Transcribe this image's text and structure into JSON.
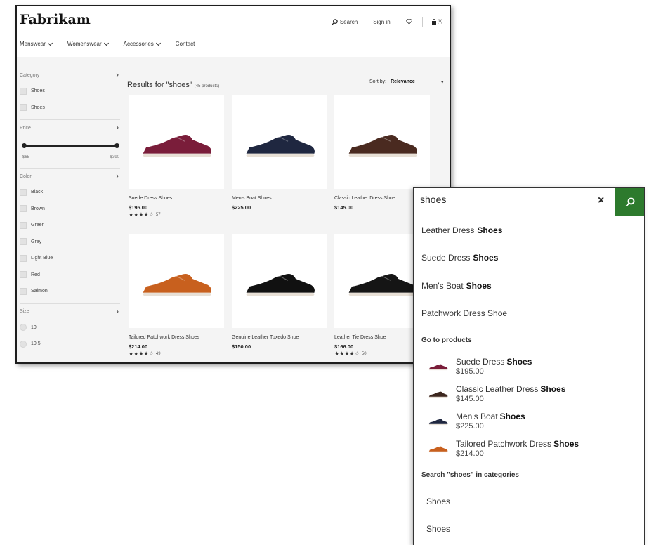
{
  "header": {
    "logo": "Fabrikam",
    "search_label": "Search",
    "signin_label": "Sign in",
    "cart_count": "(0)"
  },
  "nav": [
    {
      "label": "Menswear"
    },
    {
      "label": "Womenswear"
    },
    {
      "label": "Accessories"
    },
    {
      "label": "Contact"
    }
  ],
  "filters": {
    "category": {
      "title": "Category",
      "items": [
        "Shoes",
        "Shoes"
      ]
    },
    "price": {
      "title": "Price",
      "min": "$65",
      "max": "$390"
    },
    "color": {
      "title": "Color",
      "items": [
        "Black",
        "Brown",
        "Green",
        "Grey",
        "Light Blue",
        "Red",
        "Salmon"
      ]
    },
    "size": {
      "title": "Size",
      "items": [
        "10",
        "10.5"
      ]
    }
  },
  "results": {
    "title": "Results for \"shoes\"",
    "count": "(45 products)",
    "sort_label": "Sort by:",
    "sort_value": "Relevance",
    "sort_arrow": "▾"
  },
  "products": [
    {
      "name": "Suede Dress Shoes",
      "price": "$195.00",
      "stars": "★★★★☆",
      "rating_count": "57",
      "color": "#7a1d3a"
    },
    {
      "name": "Men's Boat Shoes",
      "price": "$225.00",
      "stars": "",
      "rating_count": "",
      "color": "#1f2740"
    },
    {
      "name": "Classic Leather Dress Shoe",
      "price": "$145.00",
      "stars": "",
      "rating_count": "",
      "color": "#4a2a20"
    },
    {
      "name": "Tailored Patchwork Dress Shoes",
      "price": "$214.00",
      "stars": "★★★★☆",
      "rating_count": "49",
      "color": "#c8601e"
    },
    {
      "name": "Genuine Leather Tuxedo Shoe",
      "price": "$150.00",
      "stars": "",
      "rating_count": "",
      "color": "#111111"
    },
    {
      "name": "Leather Tie Dress Shoe",
      "price": "$166.00",
      "stars": "★★★★☆",
      "rating_count": "50",
      "color": "#151515"
    }
  ],
  "search_popup": {
    "query": "shoes",
    "clear_symbol": "×",
    "suggestions": [
      {
        "prefix": "Leather Dress",
        "bold": "Shoes"
      },
      {
        "prefix": "Suede Dress",
        "bold": "Shoes"
      },
      {
        "prefix": "Men's Boat",
        "bold": "Shoes"
      },
      {
        "prefix": "Patchwork Dress Shoe",
        "bold": ""
      }
    ],
    "products_heading": "Go to products",
    "products": [
      {
        "prefix": "Suede Dress",
        "bold": "Shoes",
        "price": "$195.00",
        "color": "#7a1d3a"
      },
      {
        "prefix": "Classic Leather Dress",
        "bold": "Shoes",
        "price": "$145.00",
        "color": "#3c261e"
      },
      {
        "prefix": "Men's Boat",
        "bold": "Shoes",
        "price": "$225.00",
        "color": "#1f2740"
      },
      {
        "prefix": "Tailored Patchwork Dress",
        "bold": "Shoes",
        "price": "$214.00",
        "color": "#c8601e"
      }
    ],
    "categories_heading": "Search \"shoes\" in categories",
    "categories": [
      "Shoes",
      "Shoes"
    ]
  },
  "colors": {
    "search_button": "#2d7a2d",
    "page_background": "#f4f4f4"
  }
}
